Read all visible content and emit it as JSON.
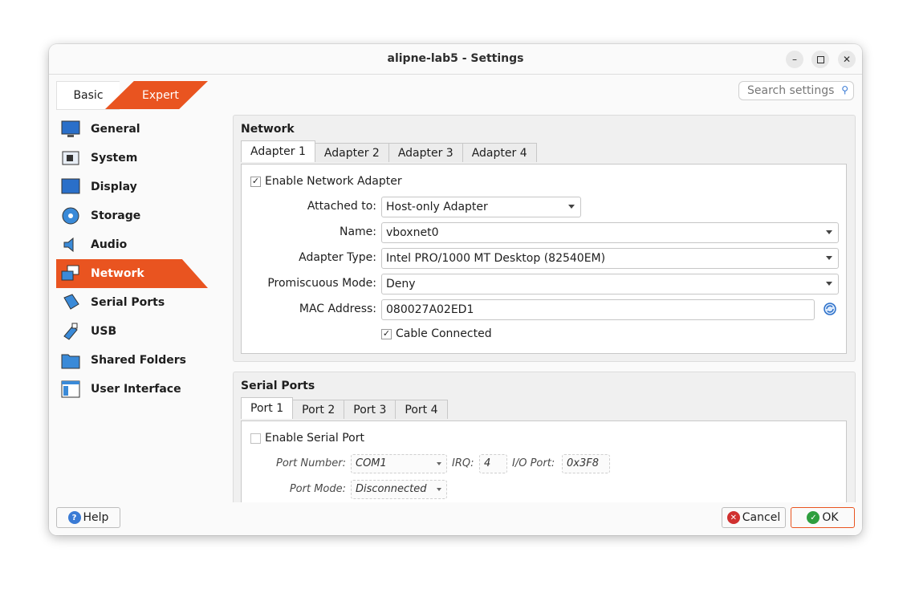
{
  "window": {
    "title": "alipne-lab5 - Settings"
  },
  "mode_tabs": {
    "basic": "Basic",
    "expert": "Expert"
  },
  "search": {
    "placeholder": "Search settings"
  },
  "sidebar": {
    "items": [
      {
        "label": "General",
        "icon": "monitor-icon"
      },
      {
        "label": "System",
        "icon": "chip-icon"
      },
      {
        "label": "Display",
        "icon": "display-icon"
      },
      {
        "label": "Storage",
        "icon": "disk-icon"
      },
      {
        "label": "Audio",
        "icon": "speaker-icon"
      },
      {
        "label": "Network",
        "icon": "network-icon",
        "active": true
      },
      {
        "label": "Serial Ports",
        "icon": "serial-icon"
      },
      {
        "label": "USB",
        "icon": "usb-icon"
      },
      {
        "label": "Shared Folders",
        "icon": "folder-icon"
      },
      {
        "label": "User Interface",
        "icon": "window-icon"
      }
    ]
  },
  "network": {
    "title": "Network",
    "tabs": [
      "Adapter 1",
      "Adapter 2",
      "Adapter 3",
      "Adapter 4"
    ],
    "enable_label": "Enable Network Adapter",
    "enabled": true,
    "attached_label": "Attached to:",
    "attached_value": "Host-only Adapter",
    "name_label": "Name:",
    "name_value": "vboxnet0",
    "adapter_type_label": "Adapter Type:",
    "adapter_type_value": "Intel PRO/1000 MT Desktop (82540EM)",
    "promiscuous_label": "Promiscuous Mode:",
    "promiscuous_value": "Deny",
    "mac_label": "MAC Address:",
    "mac_value": "080027A02ED1",
    "cable_label": "Cable Connected",
    "cable_connected": true
  },
  "serial": {
    "title": "Serial Ports",
    "tabs": [
      "Port 1",
      "Port 2",
      "Port 3",
      "Port 4"
    ],
    "enable_label": "Enable Serial Port",
    "enabled": false,
    "port_number_label": "Port Number:",
    "port_number_value": "COM1",
    "irq_label": "IRQ:",
    "irq_value": "4",
    "io_port_label": "I/O Port:",
    "io_port_value": "0x3F8",
    "port_mode_label": "Port Mode:",
    "port_mode_value": "Disconnected"
  },
  "buttons": {
    "help": "Help",
    "cancel": "Cancel",
    "ok": "OK"
  },
  "colors": {
    "accent": "#e95420",
    "icon_blue": "#2a6fc9"
  }
}
